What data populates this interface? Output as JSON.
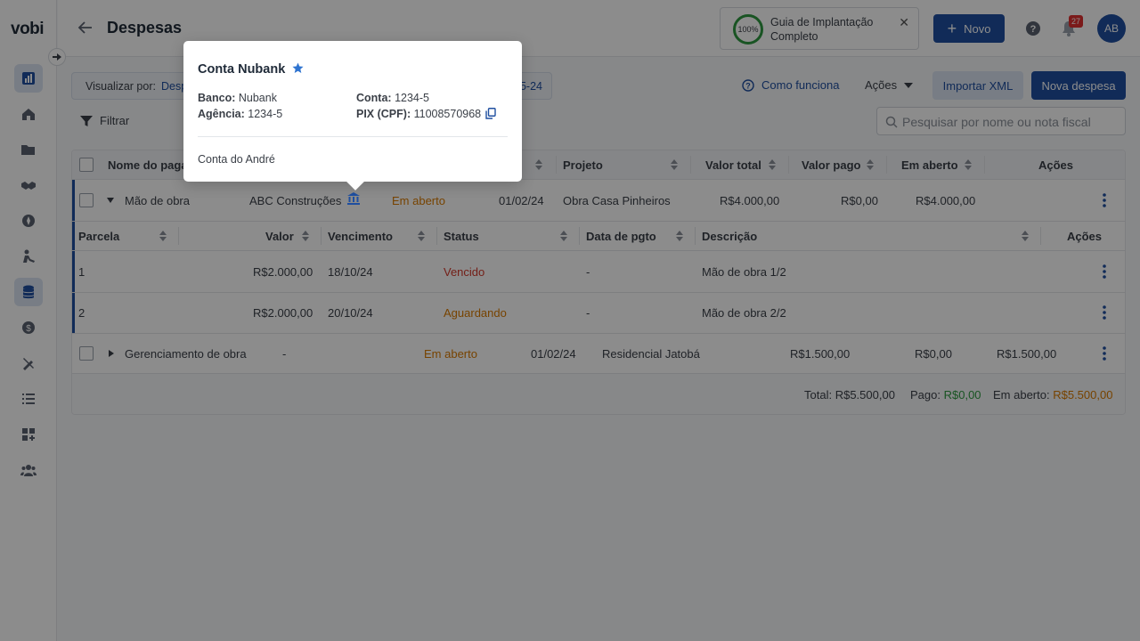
{
  "app": {
    "logo": "vobi"
  },
  "header": {
    "title": "Despesas",
    "guide": {
      "percent": "100%",
      "title": "Guia de Implantação",
      "subtitle": "Completo"
    },
    "new_label": "Novo",
    "notifications_count": "27",
    "avatar_initials": "AB"
  },
  "toolbar": {
    "view_by_label": "Visualizar por:",
    "view_by_value": "Desp",
    "view_by_date": "5-24",
    "how_it_works": "Como funciona",
    "actions_label": "Ações",
    "import_label": "Importar XML",
    "new_expense_label": "Nova despesa",
    "filter_label": "Filtrar",
    "search_placeholder": "Pesquisar por nome ou nota fiscal"
  },
  "table": {
    "headers": {
      "name": "Nome do pagar",
      "project": "Projeto",
      "total": "Valor total",
      "paid": "Valor pago",
      "open": "Em aberto",
      "actions": "Ações"
    },
    "rows": [
      {
        "name": "Mão de obra",
        "supplier": "ABC Construções",
        "status": "Em aberto",
        "date": "01/02/24",
        "project": "Obra Casa Pinheiros",
        "total": "R$4.000,00",
        "paid": "R$0,00",
        "open": "R$4.000,00"
      },
      {
        "name": "Gerenciamento de obra",
        "supplier": "-",
        "status": "Em aberto",
        "date": "01/02/24",
        "project": "Residencial Jatobá",
        "total": "R$1.500,00",
        "paid": "R$0,00",
        "open": "R$1.500,00"
      }
    ],
    "installments": {
      "headers": {
        "parcela": "Parcela",
        "valor": "Valor",
        "vencimento": "Vencimento",
        "status": "Status",
        "data_pgto": "Data de pgto",
        "descricao": "Descrição",
        "acoes": "Ações"
      },
      "rows": [
        {
          "parcela": "1",
          "valor": "R$2.000,00",
          "vencimento": "18/10/24",
          "status": "Vencido",
          "data_pgto": "-",
          "descricao": "Mão de obra 1/2"
        },
        {
          "parcela": "2",
          "valor": "R$2.000,00",
          "vencimento": "20/10/24",
          "status": "Aguardando",
          "data_pgto": "-",
          "descricao": "Mão de obra 2/2"
        }
      ]
    },
    "footer": {
      "total_label": "Total:",
      "total_value": "R$5.500,00",
      "paid_label": "Pago:",
      "paid_value": "R$0,00",
      "open_label": "Em aberto:",
      "open_value": "R$5.500,00"
    }
  },
  "popover": {
    "title": "Conta Nubank",
    "bank_label": "Banco:",
    "bank_value": "Nubank",
    "agency_label": "Agência:",
    "agency_value": "1234-5",
    "account_label": "Conta:",
    "account_value": "1234-5",
    "pix_label": "PIX (CPF):",
    "pix_value": "11008570968",
    "note": "Conta do André"
  },
  "colors": {
    "primary": "#1f4fa0",
    "warning": "#d97a00",
    "danger": "#d33a2c",
    "success": "#2e9a40"
  }
}
